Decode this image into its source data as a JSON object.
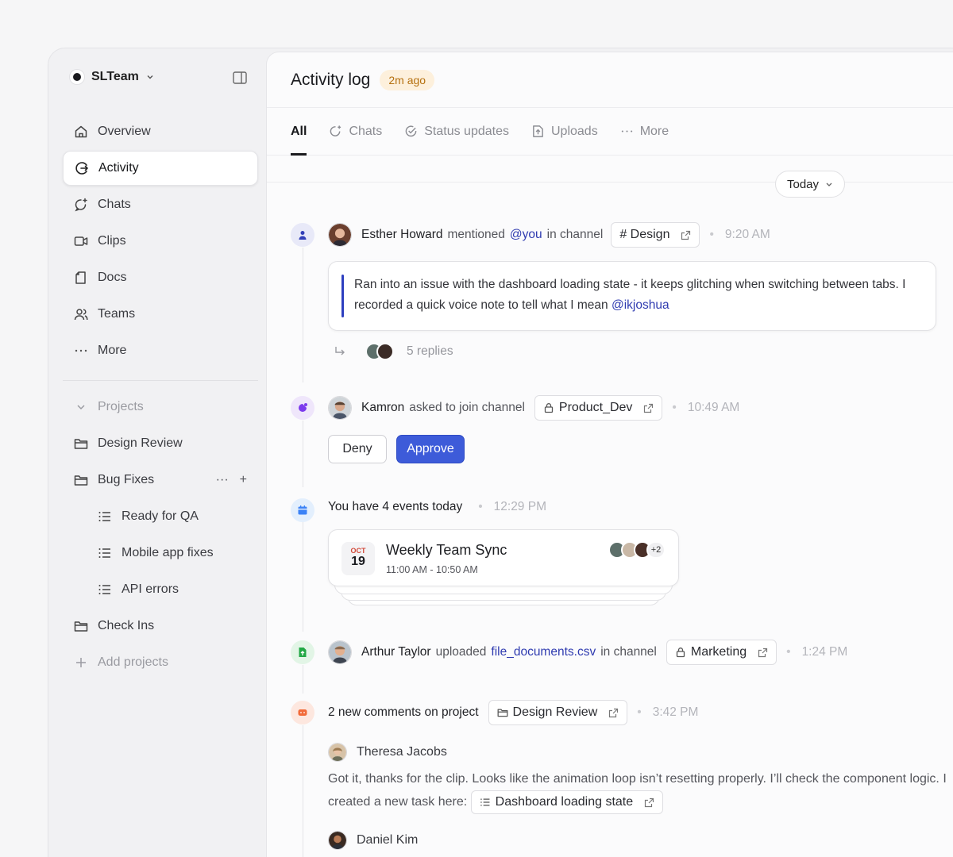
{
  "workspace": {
    "name": "SLTeam"
  },
  "nav": [
    {
      "label": "Overview",
      "icon": "home-icon"
    },
    {
      "label": "Activity",
      "icon": "activity-icon",
      "active": true
    },
    {
      "label": "Chats",
      "icon": "chat-icon"
    },
    {
      "label": "Clips",
      "icon": "video-icon"
    },
    {
      "label": "Docs",
      "icon": "doc-icon"
    },
    {
      "label": "Teams",
      "icon": "users-icon"
    },
    {
      "label": "More",
      "icon": "more-icon"
    }
  ],
  "projects": {
    "header": "Projects",
    "items": [
      "Design Review",
      "Bug Fixes",
      "Ready for QA",
      "Mobile app fixes",
      "API errors",
      "Check Ins"
    ],
    "add": "Add projects"
  },
  "header": {
    "title": "Activity log",
    "badge": "2m ago"
  },
  "tabs": [
    "All",
    "Chats",
    "Status updates",
    "Uploads",
    "More"
  ],
  "date_filter": "Today",
  "events": {
    "mention": {
      "user": "Esther Howard",
      "action": "mentioned",
      "mention": "@you",
      "in": "in channel",
      "channel": "# Design",
      "time": "9:20 AM",
      "message": "Ran into an issue with the dashboard loading state - it keeps glitching when switching between tabs. I recorded a quick voice note to tell what I mean ",
      "message_mention": "@ikjoshua",
      "replies": "5 replies"
    },
    "join": {
      "user": "Kamron",
      "action": "asked to join channel",
      "channel": "Product_Dev",
      "time": "10:49 AM",
      "deny": "Deny",
      "approve": "Approve"
    },
    "calendar": {
      "text": "You have 4 events today",
      "time": "12:29 PM",
      "month": "OCT",
      "day": "19",
      "title": "Weekly Team Sync",
      "range": "11:00 AM - 10:50 AM",
      "extra": "+2"
    },
    "upload": {
      "user": "Arthur Taylor",
      "action": "uploaded",
      "file": "file_documents.csv",
      "in": "in channel",
      "channel": "Marketing",
      "time": "1:24 PM"
    },
    "comments": {
      "text": "2 new comments on project",
      "project": "Design Review",
      "time": "3:42 PM",
      "c1_user": "Theresa Jacobs",
      "c1_text": "Got it, thanks for the clip. Looks like the animation loop isn’t resetting properly. I’ll check the component logic. I created a new task here:",
      "c1_task": "Dashboard loading state",
      "c2_user": "Daniel Kim"
    }
  },
  "colors": {
    "accent": "#3d5bd9",
    "mention": "#2f3bb0",
    "badge_bg": "#fdf0dc",
    "badge_text": "#b5700f"
  }
}
